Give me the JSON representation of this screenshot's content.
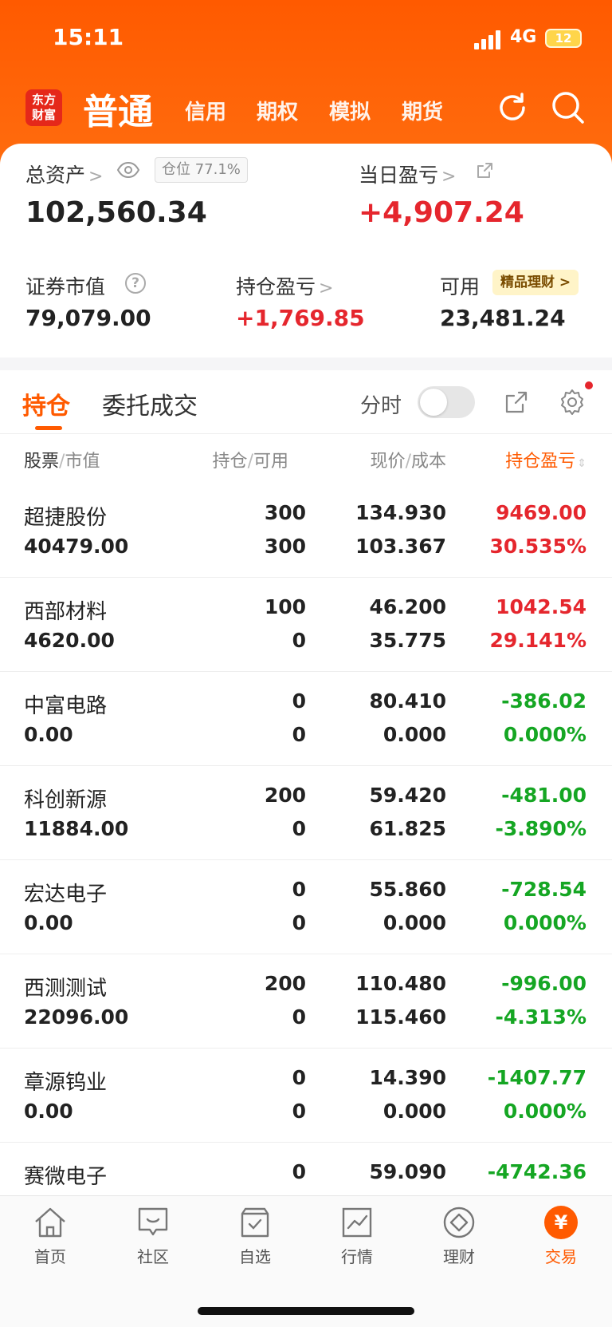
{
  "status": {
    "time": "15:11",
    "network": "4G",
    "battery": "12"
  },
  "top_nav": {
    "logo": [
      "东方",
      "财富"
    ],
    "active_tab": "普通",
    "tabs": [
      "信用",
      "期权",
      "模拟",
      "期货"
    ]
  },
  "account": {
    "total_assets_label": "总资产",
    "position_ratio": "仓位 77.1%",
    "total_assets": "102,560.34",
    "daily_pnl_label": "当日盈亏",
    "daily_pnl": "+4,907.24",
    "securities_value_label": "证券市值",
    "securities_value": "79,079.00",
    "position_pnl_label": "持仓盈亏",
    "position_pnl": "+1,769.85",
    "available_label": "可用",
    "premium_badge": "精品理财",
    "available": "23,481.24"
  },
  "section_tabs": {
    "active": "持仓",
    "other": "委托成交",
    "fenshi_label": "分时"
  },
  "columns": {
    "stock": "股票",
    "market_value": "市值",
    "holding": "持仓",
    "usable": "可用",
    "price": "现价",
    "cost": "成本",
    "pnl": "持仓盈亏",
    "slash": "/"
  },
  "holdings": [
    {
      "name": "超捷股份",
      "market_value": "40479.00",
      "holding": "300",
      "usable": "300",
      "price": "134.930",
      "cost": "103.367",
      "pnl": "9469.00",
      "pnl_pct": "30.535%",
      "color": "#e5262d"
    },
    {
      "name": "西部材料",
      "market_value": "4620.00",
      "holding": "100",
      "usable": "0",
      "price": "46.200",
      "cost": "35.775",
      "pnl": "1042.54",
      "pnl_pct": "29.141%",
      "color": "#e5262d"
    },
    {
      "name": "中富电路",
      "market_value": "0.00",
      "holding": "0",
      "usable": "0",
      "price": "80.410",
      "cost": "0.000",
      "pnl": "-386.02",
      "pnl_pct": "0.000%",
      "color": "#15a623"
    },
    {
      "name": "科创新源",
      "market_value": "11884.00",
      "holding": "200",
      "usable": "0",
      "price": "59.420",
      "cost": "61.825",
      "pnl": "-481.00",
      "pnl_pct": "-3.890%",
      "color": "#15a623"
    },
    {
      "name": "宏达电子",
      "market_value": "0.00",
      "holding": "0",
      "usable": "0",
      "price": "55.860",
      "cost": "0.000",
      "pnl": "-728.54",
      "pnl_pct": "0.000%",
      "color": "#15a623"
    },
    {
      "name": "西测测试",
      "market_value": "22096.00",
      "holding": "200",
      "usable": "0",
      "price": "110.480",
      "cost": "115.460",
      "pnl": "-996.00",
      "pnl_pct": "-4.313%",
      "color": "#15a623"
    },
    {
      "name": "章源钨业",
      "market_value": "0.00",
      "holding": "0",
      "usable": "0",
      "price": "14.390",
      "cost": "0.000",
      "pnl": "-1407.77",
      "pnl_pct": "0.000%",
      "color": "#15a623"
    },
    {
      "name": "赛微电子",
      "market_value": "",
      "holding": "0",
      "usable": "",
      "price": "59.090",
      "cost": "",
      "pnl": "-4742.36",
      "pnl_pct": "",
      "color": "#15a623"
    }
  ],
  "bottom_nav": [
    "首页",
    "社区",
    "自选",
    "行情",
    "理财",
    "交易"
  ],
  "colors": {
    "brand": "#ff5a00",
    "up": "#e5262d",
    "down": "#15a623"
  }
}
